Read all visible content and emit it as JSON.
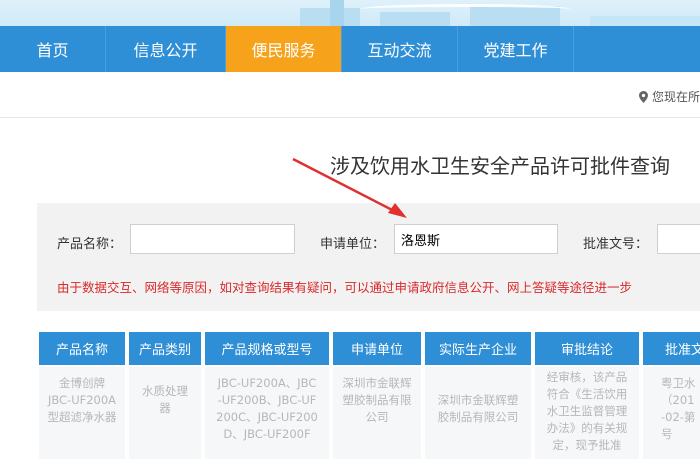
{
  "nav": {
    "items": [
      {
        "label": "首页"
      },
      {
        "label": "信息公开"
      },
      {
        "label": "便民服务"
      },
      {
        "label": "互动交流"
      },
      {
        "label": "党建工作"
      }
    ]
  },
  "location_text": "您现在所",
  "page_title": "涉及饮用水卫生安全产品许可批件查询",
  "search": {
    "product_name_label": "产品名称：",
    "product_name_value": "",
    "applicant_label": "申请单位：",
    "applicant_value": "洛恩斯",
    "approval_no_label": "批准文号：",
    "approval_no_value": ""
  },
  "notice": "由于数据交互、网络等原因，如对查询结果有疑问，可以通过申请政府信息公开、网上答疑等途径进一步",
  "table": {
    "headers": [
      "产品名称",
      "产品类别",
      "产品规格或型号",
      "申请单位",
      "实际生产企业",
      "审批结论",
      "批准文"
    ],
    "row": [
      [
        "金博创牌",
        "JBC-UF200A",
        "型超滤净水器"
      ],
      [
        "水质处理",
        "器"
      ],
      [
        "JBC-UF200A、JBC",
        "-UF200B、JBC-UF",
        "200C、JBC-UF200",
        "D、JBC-UF200F"
      ],
      [
        "深圳市金联辉",
        "塑胶制品有限",
        "公司"
      ],
      [
        "深圳市金联辉塑",
        "胶制品有限公司"
      ],
      [
        "经审核，该产品",
        "符合《生活饮用",
        "水卫生监督管理",
        "办法》的有关规",
        "定，现予批准"
      ],
      [
        "粤卫水",
        "（201",
        "-02-第",
        "号"
      ]
    ]
  },
  "colors": {
    "nav_bg": "#2f8fd6",
    "nav_active": "#f6a31b",
    "notice_red": "#d9292b",
    "arrow_red": "#e03030"
  }
}
